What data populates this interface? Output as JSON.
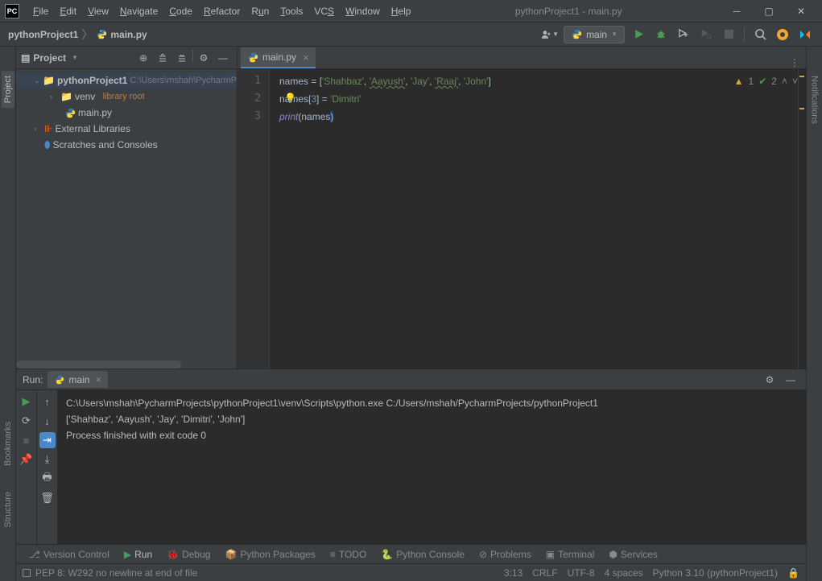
{
  "window": {
    "title": "pythonProject1 - main.py"
  },
  "menu": [
    "File",
    "Edit",
    "View",
    "Navigate",
    "Code",
    "Refactor",
    "Run",
    "Tools",
    "VCS",
    "Window",
    "Help"
  ],
  "breadcrumb": {
    "project": "pythonProject1",
    "file": "main.py"
  },
  "runConfig": {
    "label": "main"
  },
  "projectPanel": {
    "title": "Project",
    "root": "pythonProject1",
    "rootPath": "C:\\Users\\mshah\\PycharmP",
    "venv": "venv",
    "venvHint": "library root",
    "mainPy": "main.py",
    "extLibs": "External Libraries",
    "scratches": "Scratches and Consoles"
  },
  "editor": {
    "tabName": "main.py",
    "lines": [
      "1",
      "2",
      "3"
    ],
    "code": {
      "l1_names": "names ",
      "l1_eq": "= [",
      "l1_s1": "'Shahbaz'",
      "l1_c": ", ",
      "l1_s2": "'Aayush'",
      "l1_s3": "'Jay'",
      "l1_s4": "'Raaj'",
      "l1_s5": "'John'",
      "l1_close": "]",
      "l2_names": "names[",
      "l2_idx": "3",
      "l2_rest": "] = ",
      "l2_val": "'Dimitri'",
      "l3_print": "print",
      "l3_open": "(",
      "l3_arg": "names",
      "l3_close": ")"
    },
    "inspections": {
      "warn": "1",
      "typo": "2"
    }
  },
  "run": {
    "label": "Run:",
    "tab": "main",
    "line1": "C:\\Users\\mshah\\PycharmProjects\\pythonProject1\\venv\\Scripts\\python.exe C:/Users/mshah/PycharmProjects/pythonProject1",
    "line2": "['Shahbaz', 'Aayush', 'Jay', 'Dimitri', 'John']",
    "line3": "",
    "line4": "Process finished with exit code 0"
  },
  "bottomTabs": {
    "vcs": "Version Control",
    "run": "Run",
    "debug": "Debug",
    "pkg": "Python Packages",
    "todo": "TODO",
    "pycon": "Python Console",
    "prob": "Problems",
    "term": "Terminal",
    "svc": "Services"
  },
  "status": {
    "msg": "PEP 8: W292 no newline at end of file",
    "pos": "3:13",
    "eol": "CRLF",
    "enc": "UTF-8",
    "indent": "4 spaces",
    "interp": "Python 3.10 (pythonProject1)"
  },
  "sideTabs": {
    "proj": "Project",
    "bkm": "Bookmarks",
    "struct": "Structure",
    "notif": "Notifications"
  }
}
